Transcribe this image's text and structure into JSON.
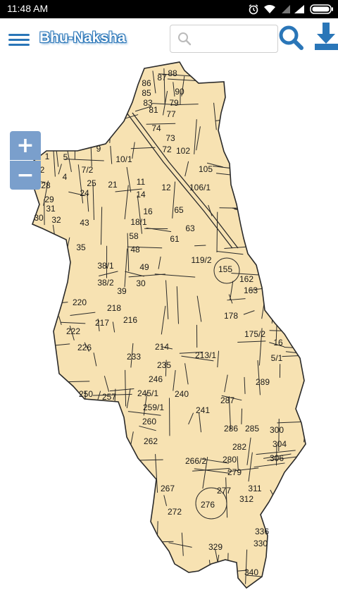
{
  "status_bar": {
    "time": "11:48 AM",
    "icons": [
      "alarm-icon",
      "wifi-icon",
      "signal-icon",
      "battery-icon"
    ]
  },
  "app_bar": {
    "title": "Bhu-Naksha",
    "search_placeholder": "",
    "search_value": "",
    "icons": [
      "menu-icon",
      "search-icon",
      "download-icon"
    ]
  },
  "map": {
    "zoom_in_label": "+",
    "zoom_out_label": "−",
    "parcel_fill_color": "#f7e2b2",
    "parcel_line_color": "#2a2a2a",
    "plot_numbers": [
      {
        "text": "87"
      },
      {
        "text": "88"
      },
      {
        "text": "86"
      },
      {
        "text": "85"
      },
      {
        "text": "90"
      },
      {
        "text": "79"
      },
      {
        "text": "83"
      },
      {
        "text": "81"
      },
      {
        "text": "77"
      },
      {
        "text": "74"
      },
      {
        "text": "73"
      },
      {
        "text": "72"
      },
      {
        "text": "102"
      },
      {
        "text": "9"
      },
      {
        "text": "10/1"
      },
      {
        "text": "105"
      },
      {
        "text": "1"
      },
      {
        "text": "5"
      },
      {
        "text": "2"
      },
      {
        "text": "4"
      },
      {
        "text": "7/2"
      },
      {
        "text": "28"
      },
      {
        "text": "25"
      },
      {
        "text": "24"
      },
      {
        "text": "21"
      },
      {
        "text": "11"
      },
      {
        "text": "12"
      },
      {
        "text": "14"
      },
      {
        "text": "106/1"
      },
      {
        "text": "29"
      },
      {
        "text": "31"
      },
      {
        "text": "16"
      },
      {
        "text": "65"
      },
      {
        "text": "30"
      },
      {
        "text": "32"
      },
      {
        "text": "43"
      },
      {
        "text": "18/1"
      },
      {
        "text": "63"
      },
      {
        "text": "58"
      },
      {
        "text": "48"
      },
      {
        "text": "61"
      },
      {
        "text": "35"
      },
      {
        "text": "119/2"
      },
      {
        "text": "155"
      },
      {
        "text": "38/1"
      },
      {
        "text": "49"
      },
      {
        "text": "162"
      },
      {
        "text": "38/2"
      },
      {
        "text": "30"
      },
      {
        "text": "39"
      },
      {
        "text": "163"
      },
      {
        "text": "220"
      },
      {
        "text": "218"
      },
      {
        "text": "178"
      },
      {
        "text": "216"
      },
      {
        "text": "217"
      },
      {
        "text": "175/2"
      },
      {
        "text": "222"
      },
      {
        "text": "226"
      },
      {
        "text": "214"
      },
      {
        "text": "16"
      },
      {
        "text": "213/1"
      },
      {
        "text": "233"
      },
      {
        "text": "235"
      },
      {
        "text": "5/1"
      },
      {
        "text": "246"
      },
      {
        "text": "289"
      },
      {
        "text": "250"
      },
      {
        "text": "257"
      },
      {
        "text": "245/1"
      },
      {
        "text": "240"
      },
      {
        "text": "287"
      },
      {
        "text": "259/1"
      },
      {
        "text": "241"
      },
      {
        "text": "260"
      },
      {
        "text": "286"
      },
      {
        "text": "285"
      },
      {
        "text": "300"
      },
      {
        "text": "262"
      },
      {
        "text": "282"
      },
      {
        "text": "304"
      },
      {
        "text": "266/2"
      },
      {
        "text": "280"
      },
      {
        "text": "306"
      },
      {
        "text": "279"
      },
      {
        "text": "267"
      },
      {
        "text": "277"
      },
      {
        "text": "311"
      },
      {
        "text": "312"
      },
      {
        "text": "276"
      },
      {
        "text": "272"
      },
      {
        "text": "336"
      },
      {
        "text": "330"
      },
      {
        "text": "329"
      },
      {
        "text": "340"
      }
    ]
  }
}
